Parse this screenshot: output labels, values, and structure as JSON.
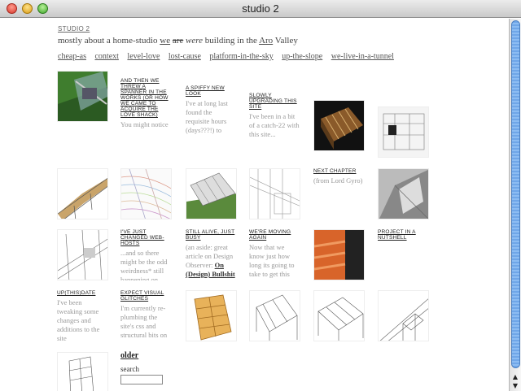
{
  "window": {
    "title": "studio 2"
  },
  "site": {
    "title": "STUDIO 2",
    "tagline": {
      "a": "mostly about a home-studio ",
      "we": "we",
      "are": "are",
      "were": "were",
      "b": " building in the ",
      "aro": "Aro",
      "c": " Valley"
    }
  },
  "nav": [
    "cheap-as",
    "context",
    "level-love",
    "lost-cause",
    "platform-in-the-sky",
    "up-the-slope",
    "we-live-in-a-tunnel"
  ],
  "posts": [
    {
      "heading": "AND THEN WE THREW A SPANNER IN THE WORKS (OR HOW WE CAME TO ACQUIRE THE LOVE SHACK)",
      "excerpt": "You might notice that its been a"
    },
    {
      "heading": "A SPIFFY NEW LOOK",
      "excerpt": "I've at long last found the requisite hours (days???!) to"
    },
    {
      "heading": "SLOWLY UPGRADING THIS SITE",
      "excerpt": "I've been in a bit of a catch-22 with this site..."
    },
    {
      "heading": "NEXT CHAPTER",
      "excerpt": "(from Lord Gyro)"
    },
    {
      "heading": "I'VE JUST CHANGED WEB-HOSTS",
      "excerpt": "...and so there might be the odd weirdness* still happening on"
    },
    {
      "heading": "STILL ALIVE, JUST BUSY",
      "excerpt": "(an aside: great article on Design Observer: ",
      "link": "On (Design) Bullshit"
    },
    {
      "heading": "WE'RE MOVING AGAIN",
      "excerpt": "Now that we know just how long its going to take to get this"
    },
    {
      "heading": "PROJECT IN A NUTSHELL",
      "excerpt": ""
    },
    {
      "heading": "UP(THIS)DATE",
      "excerpt": "I've been tweaking some changes and additions to the site"
    },
    {
      "heading": "EXPECT VISUAL GLITCHES",
      "excerpt": "I'm currently re-plumbing the site's css and structural bits on"
    }
  ],
  "footer": {
    "older": "older",
    "search_label": "search",
    "search_value": ""
  }
}
